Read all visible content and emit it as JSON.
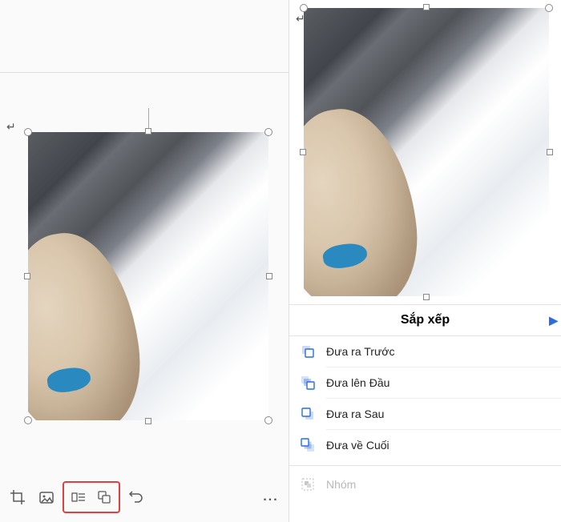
{
  "arrange": {
    "title": "Sắp xếp",
    "items": [
      {
        "label": "Đưa ra Trước"
      },
      {
        "label": "Đưa lên Đầu"
      },
      {
        "label": "Đưa ra Sau"
      },
      {
        "label": "Đưa về Cuối"
      }
    ],
    "group_label": "Nhóm"
  },
  "toolbar": {
    "more": "..."
  }
}
